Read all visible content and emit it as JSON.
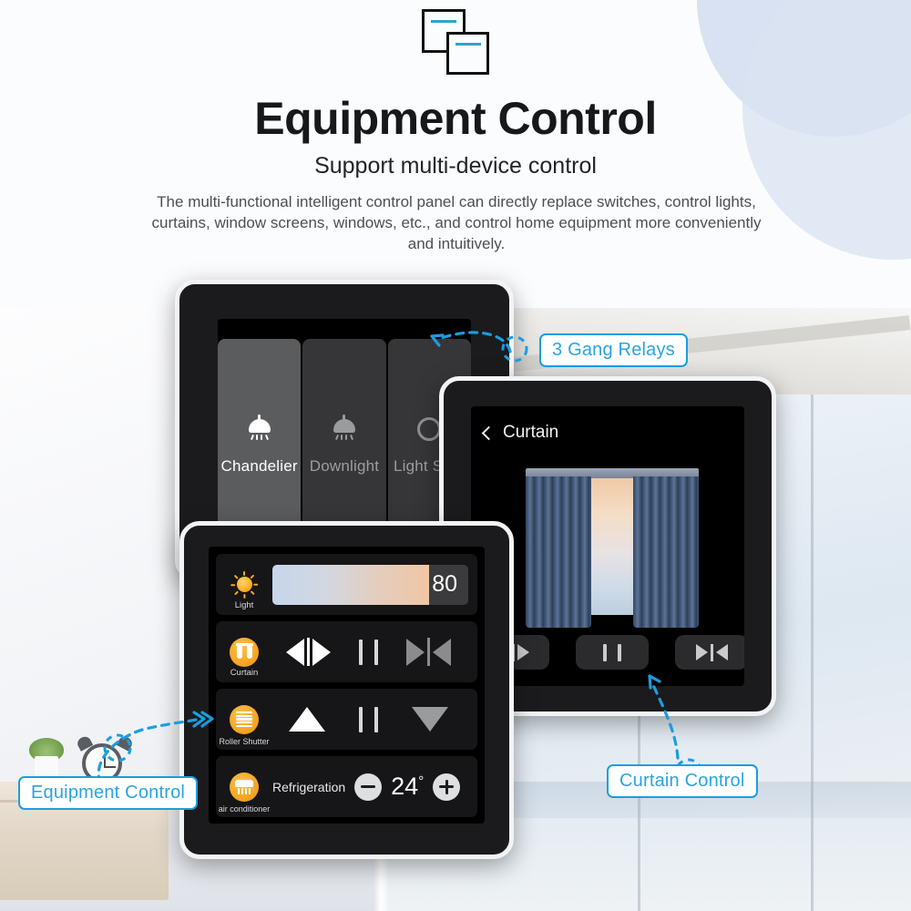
{
  "header": {
    "logo_name": "overlapping-squares-logo",
    "title": "Equipment Control",
    "subtitle": "Support multi-device control",
    "description": "The multi-functional intelligent control panel can directly replace switches, control lights, curtains, window screens, windows, etc., and control home equipment more conveniently and intuitively.",
    "accent_color": "#2aa3e3",
    "logo_accent_color": "#2ba6c8"
  },
  "callouts": {
    "gang": "3 Gang Relays",
    "equipment": "Equipment Control",
    "curtain": "Curtain Control"
  },
  "devices": {
    "gang_relays": {
      "name": "3 Gang Relays",
      "keys": [
        {
          "label": "Chandelier",
          "icon": "chandelier-icon",
          "state": "on"
        },
        {
          "label": "Downlight",
          "icon": "downlight-icon",
          "state": "off"
        },
        {
          "label": "Light Strip",
          "icon": "light-strip-icon",
          "state": "off"
        }
      ]
    },
    "curtain_panel": {
      "back_icon": "chevron-left-icon",
      "title": "Curtain",
      "illustration": "curtain-window-illustration",
      "buttons": [
        {
          "name": "curtain-open-button",
          "glyph": "open-arrows"
        },
        {
          "name": "curtain-pause-button",
          "glyph": "pause"
        },
        {
          "name": "curtain-close-button",
          "glyph": "close-arrows"
        }
      ]
    },
    "equipment_panel": {
      "rows": [
        {
          "id": "light",
          "label": "Light",
          "icon": "sun-icon",
          "type": "slider",
          "value": "80",
          "percent": 80
        },
        {
          "id": "curtain",
          "label": "Curtain",
          "icon": "curtain-icon",
          "type": "controls",
          "controls": [
            {
              "name": "curtain-open-button",
              "active": true
            },
            {
              "name": "curtain-pause-button",
              "active": false
            },
            {
              "name": "curtain-close-button",
              "active": false
            }
          ]
        },
        {
          "id": "roller_shutter",
          "label": "Roller Shutter",
          "icon": "roller-shutter-icon",
          "type": "controls",
          "controls": [
            {
              "name": "shutter-up-button",
              "active": true
            },
            {
              "name": "shutter-pause-button",
              "active": false
            },
            {
              "name": "shutter-down-button",
              "active": false
            }
          ]
        },
        {
          "id": "air_conditioner",
          "label": "air conditioner",
          "icon": "air-conditioner-icon",
          "type": "thermostat",
          "mode": "Refrigeration",
          "temperature": "24",
          "degree_symbol": "°",
          "decrease": "minus-button",
          "increase": "plus-button"
        }
      ]
    }
  }
}
